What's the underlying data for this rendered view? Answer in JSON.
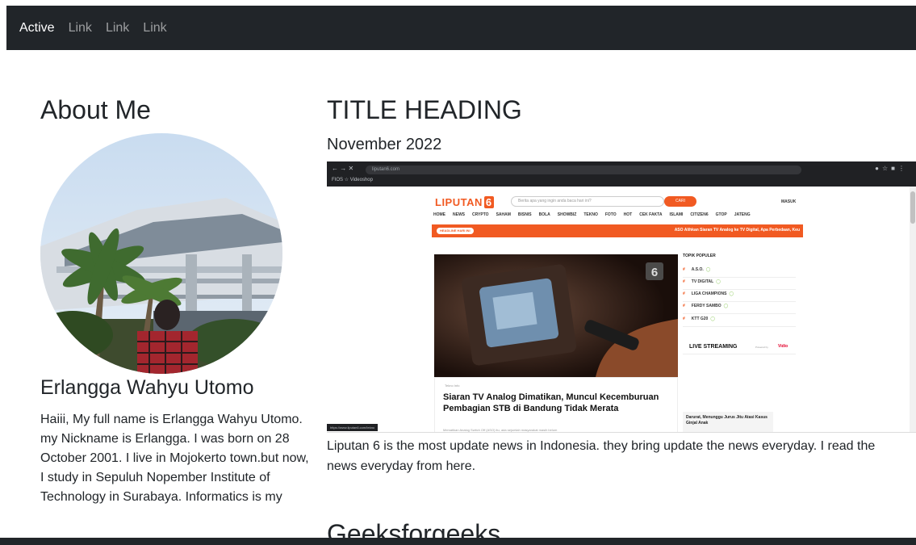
{
  "nav": {
    "items": [
      {
        "label": "Active",
        "active": true
      },
      {
        "label": "Link",
        "active": false
      },
      {
        "label": "Link",
        "active": false
      },
      {
        "label": "Link",
        "active": false
      }
    ]
  },
  "about": {
    "title": "About Me",
    "name": "Erlangga Wahyu Utomo",
    "bio": "Haiii, My full name is Erlangga Wahyu Utomo. my Nickname is Erlangga. I was born on 28 October 2001. I live in Mojokerto town.but now, I study in Sepuluh Nopember Institute of Technology in Surabaya. Informatics is my"
  },
  "post": {
    "title": "TITLE HEADING",
    "date": "November 2022",
    "description": "Liputan 6 is the most update news in Indonesia. they bring update the news everyday. I read the news everyday from here."
  },
  "next_post": {
    "title": "Geeksforgeeks"
  },
  "screenshot": {
    "url": "liputan6.com",
    "bookmarks": "FIOS   ☆ Videoshop",
    "logo": "LIPUTAN",
    "logo_num": "6",
    "search_placeholder": "Berita apa yang ingin anda baca hari ini?",
    "search_button": "CARI",
    "login": "MASUK",
    "menu": [
      "HOME",
      "NEWS",
      "CRYPTO",
      "SAHAM",
      "BISNIS",
      "BOLA",
      "SHOWBIZ",
      "TEKNO",
      "FOTO",
      "HOT",
      "CEK FAKTA",
      "ISLAMI",
      "CITIZEN6",
      "GTOP",
      "JATENG"
    ],
    "ticker_badge": "HEADLINE HARI INI",
    "ticker_text": "ASO Alihkan Siaran TV Analog ke TV Digital, Apa Perbedaan, Keu",
    "badge_num": "6",
    "card_category": "Tekno Info",
    "card_title": "Siaran TV Analog Dimatikan, Muncul Kecemburuan Pembagian STB di Bandung Tidak Merata",
    "card_sub": "Mematikan Analog Switch Off (ASO) itu, ada sejumlah masyarakat masih belum",
    "side_heading": "TOPIK POPULER",
    "topics": [
      "A.S.O.",
      "TV DIGITAL",
      "LIGA CHAMPIONS",
      "FERDY SAMBO",
      "KTT G20"
    ],
    "live_title": "LIVE STREAMING",
    "live_by": "Powered by",
    "live_logo": "Vidio",
    "side_news": "Darurat, Menunggu Jurus Jitu Atasi Kasus Ginjal Anak",
    "status_url": "https://www.liputan6.com/tekno",
    "colors": {
      "brand": "#f15a22",
      "navbar": "#212529"
    }
  }
}
